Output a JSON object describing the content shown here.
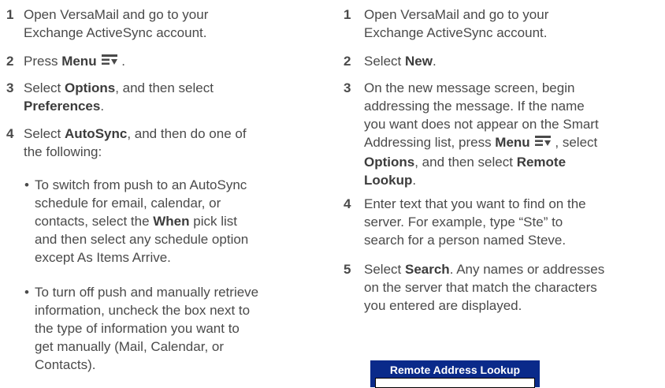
{
  "left": {
    "steps": [
      {
        "num": "1",
        "lines": [
          "Open VersaMail and go to your",
          "Exchange ActiveSync account."
        ]
      },
      {
        "num": "2",
        "pre": "Press ",
        "bold": "Menu",
        "post": " ."
      },
      {
        "num": "3",
        "pre": "Select ",
        "bold": "Options",
        "post": ", and then select",
        "bold2": "Preferences",
        "post2": "."
      },
      {
        "num": "4",
        "pre": "Select ",
        "bold": "AutoSync",
        "post": ", and then do one of",
        "line2": "the following:"
      }
    ],
    "bullets": [
      {
        "dot": "•",
        "l1": "To switch from push to an AutoSync",
        "l2": "schedule for email, calendar, or",
        "l3pre": "contacts, select the ",
        "l3bold": "When",
        "l3post": " pick list",
        "l4": "and then select any schedule option",
        "l5": "except As Items Arrive."
      },
      {
        "dot": "•",
        "l1": "To turn off push and manually retrieve",
        "l2": "information, uncheck the box next to",
        "l3": "the type of information you want to",
        "l4": "get manually (Mail, Calendar, or",
        "l5": "Contacts)."
      }
    ]
  },
  "right": {
    "steps": [
      {
        "num": "1",
        "lines": [
          "Open VersaMail and go to your",
          "Exchange ActiveSync account."
        ]
      },
      {
        "num": "2",
        "pre": "Select ",
        "bold": "New",
        "post": "."
      },
      {
        "num": "3",
        "l1": "On the new message screen, begin",
        "l2": "addressing the message. If the name",
        "l3": "you want does not appear on the Smart",
        "l4pre": "Addressing list, press ",
        "l4bold": "Menu",
        "l4post": " , select",
        "l5bold": "Options",
        "l5post": ", and then select ",
        "l5bold2": "Remote",
        "l6bold": "Lookup",
        "l6post": "."
      },
      {
        "num": "4",
        "l1": "Enter text that you want to find on the",
        "l2": "server. For example, type “Ste” to",
        "l3": "search for a person named Steve."
      },
      {
        "num": "5",
        "l1pre": "Select ",
        "l1bold": "Search",
        "l1post": ". Any names or addresses",
        "l2": "on the server that match the characters",
        "l3": "you entered are displayed."
      }
    ],
    "dialog_title": "Remote Address Lookup"
  },
  "icons": {
    "menu": "menu-icon"
  },
  "colors": {
    "dialog_bar": "#0a2a8a",
    "text": "#4a4a4a"
  }
}
